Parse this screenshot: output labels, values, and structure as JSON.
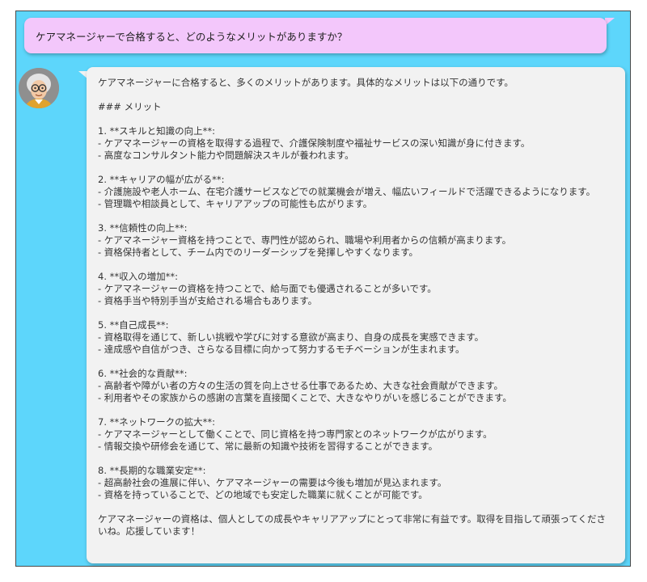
{
  "user_message": "ケアマネージャーで合格すると、どのようなメリットがありますか？",
  "response": {
    "intro": "ケアマネージャーに合格すると、多くのメリットがあります。具体的なメリットは以下の通りです。",
    "heading": "### メリット",
    "sections": [
      {
        "title": "1. **スキルと知識の向上**:",
        "bullets": [
          "- ケアマネージャーの資格を取得する過程で、介護保険制度や福祉サービスの深い知識が身に付きます。",
          "- 高度なコンサルタント能力や問題解決スキルが養われます。"
        ]
      },
      {
        "title": "2. **キャリアの幅が広がる**:",
        "bullets": [
          "- 介護施設や老人ホーム、在宅介護サービスなどでの就業機会が増え、幅広いフィールドで活躍できるようになります。",
          "- 管理職や相談員として、キャリアアップの可能性も広がります。"
        ]
      },
      {
        "title": "3. **信頼性の向上**:",
        "bullets": [
          "- ケアマネージャー資格を持つことで、専門性が認められ、職場や利用者からの信頼が高まります。",
          "- 資格保持者として、チーム内でのリーダーシップを発揮しやすくなります。"
        ]
      },
      {
        "title": "4. **収入の増加**:",
        "bullets": [
          "- ケアマネージャーの資格を持つことで、給与面でも優遇されることが多いです。",
          "- 資格手当や特別手当が支給される場合もあります。"
        ]
      },
      {
        "title": "5. **自己成長**:",
        "bullets": [
          "- 資格取得を通じて、新しい挑戦や学びに対する意欲が高まり、自身の成長を実感できます。",
          "- 達成感や自信がつき、さらなる目標に向かって努力するモチベーションが生まれます。"
        ]
      },
      {
        "title": "6. **社会的な貢献**:",
        "bullets": [
          "- 高齢者や障がい者の方々の生活の質を向上させる仕事であるため、大きな社会貢献ができます。",
          "- 利用者やその家族からの感謝の言葉を直接聞くことで、大きなやりがいを感じることができます。"
        ]
      },
      {
        "title": "7. **ネットワークの拡大**:",
        "bullets": [
          "- ケアマネージャーとして働くことで、同じ資格を持つ専門家とのネットワークが広がります。",
          "- 情報交換や研修会を通じて、常に最新の知識や技術を習得することができます。"
        ]
      },
      {
        "title": "8. **長期的な職業安定**:",
        "bullets": [
          "- 超高齢社会の進展に伴い、ケアマネージャーの需要は今後も増加が見込まれます。",
          "- 資格を持っていることで、どの地域でも安定した職業に就くことが可能です。"
        ]
      }
    ],
    "closing": "ケアマネージャーの資格は、個人としての成長やキャリアアップにとって非常に有益です。取得を目指して頑張ってくださいね。応援しています！"
  },
  "icons": {
    "avatar": "elderly-person-avatar"
  },
  "colors": {
    "background": "#5dd6fb",
    "user_bubble": "#f3c7fb",
    "assistant_bubble": "#f2f2f2"
  }
}
